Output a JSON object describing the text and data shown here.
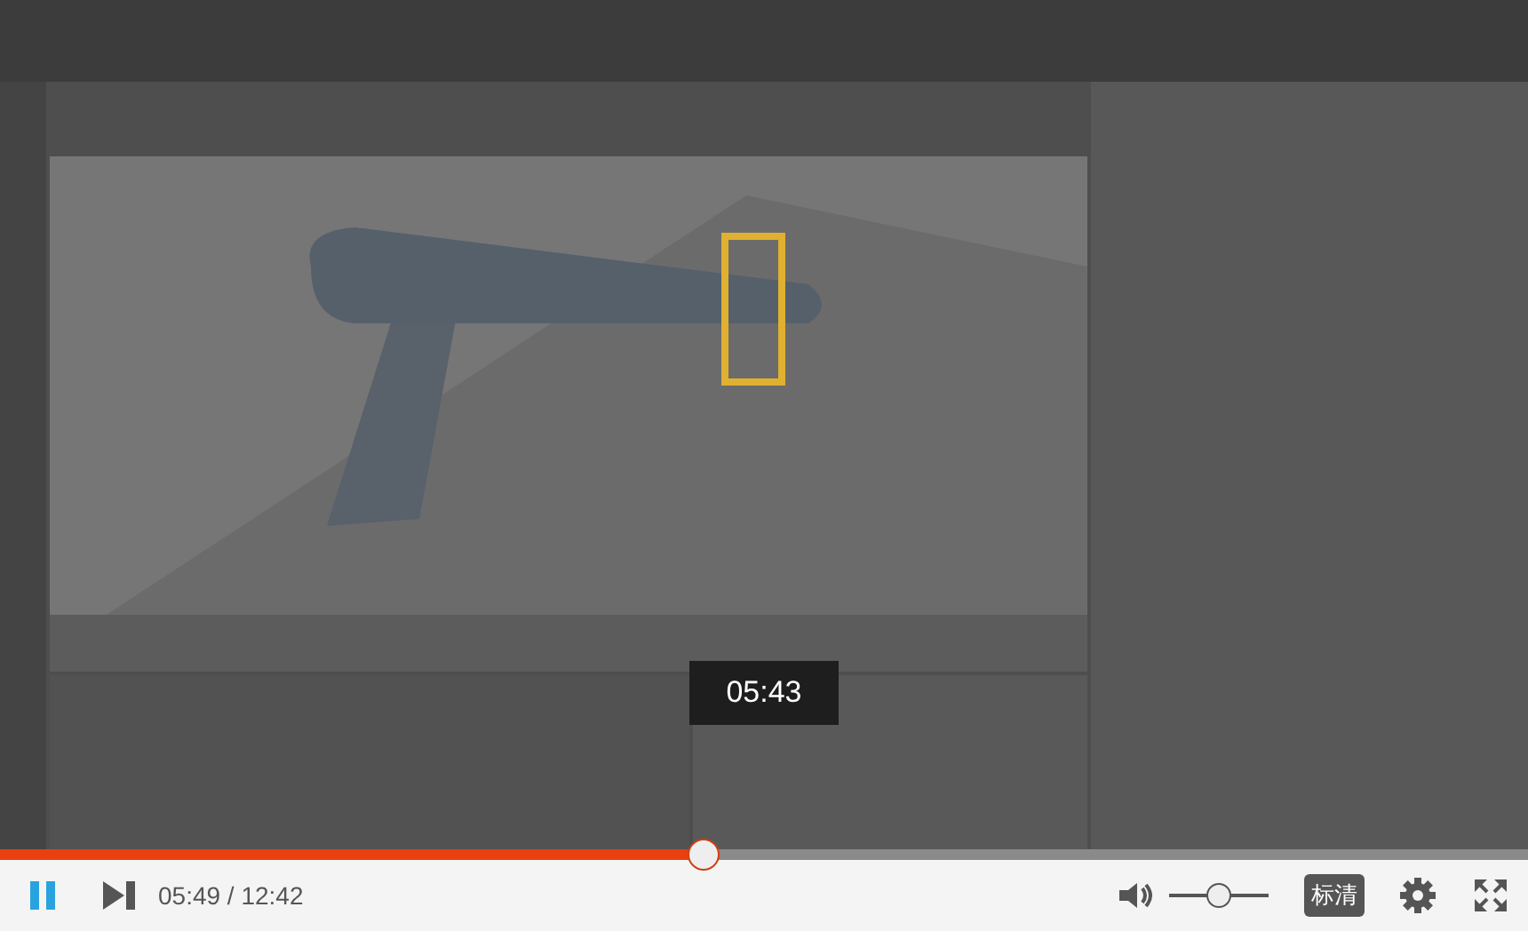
{
  "seek_tooltip": {
    "time": "05:43"
  },
  "progress": {
    "level": 0.46
  },
  "controls": {
    "playing": true,
    "time": "05:49 / 12:42",
    "volume": {
      "level": 0.5
    },
    "quality": "标清"
  }
}
